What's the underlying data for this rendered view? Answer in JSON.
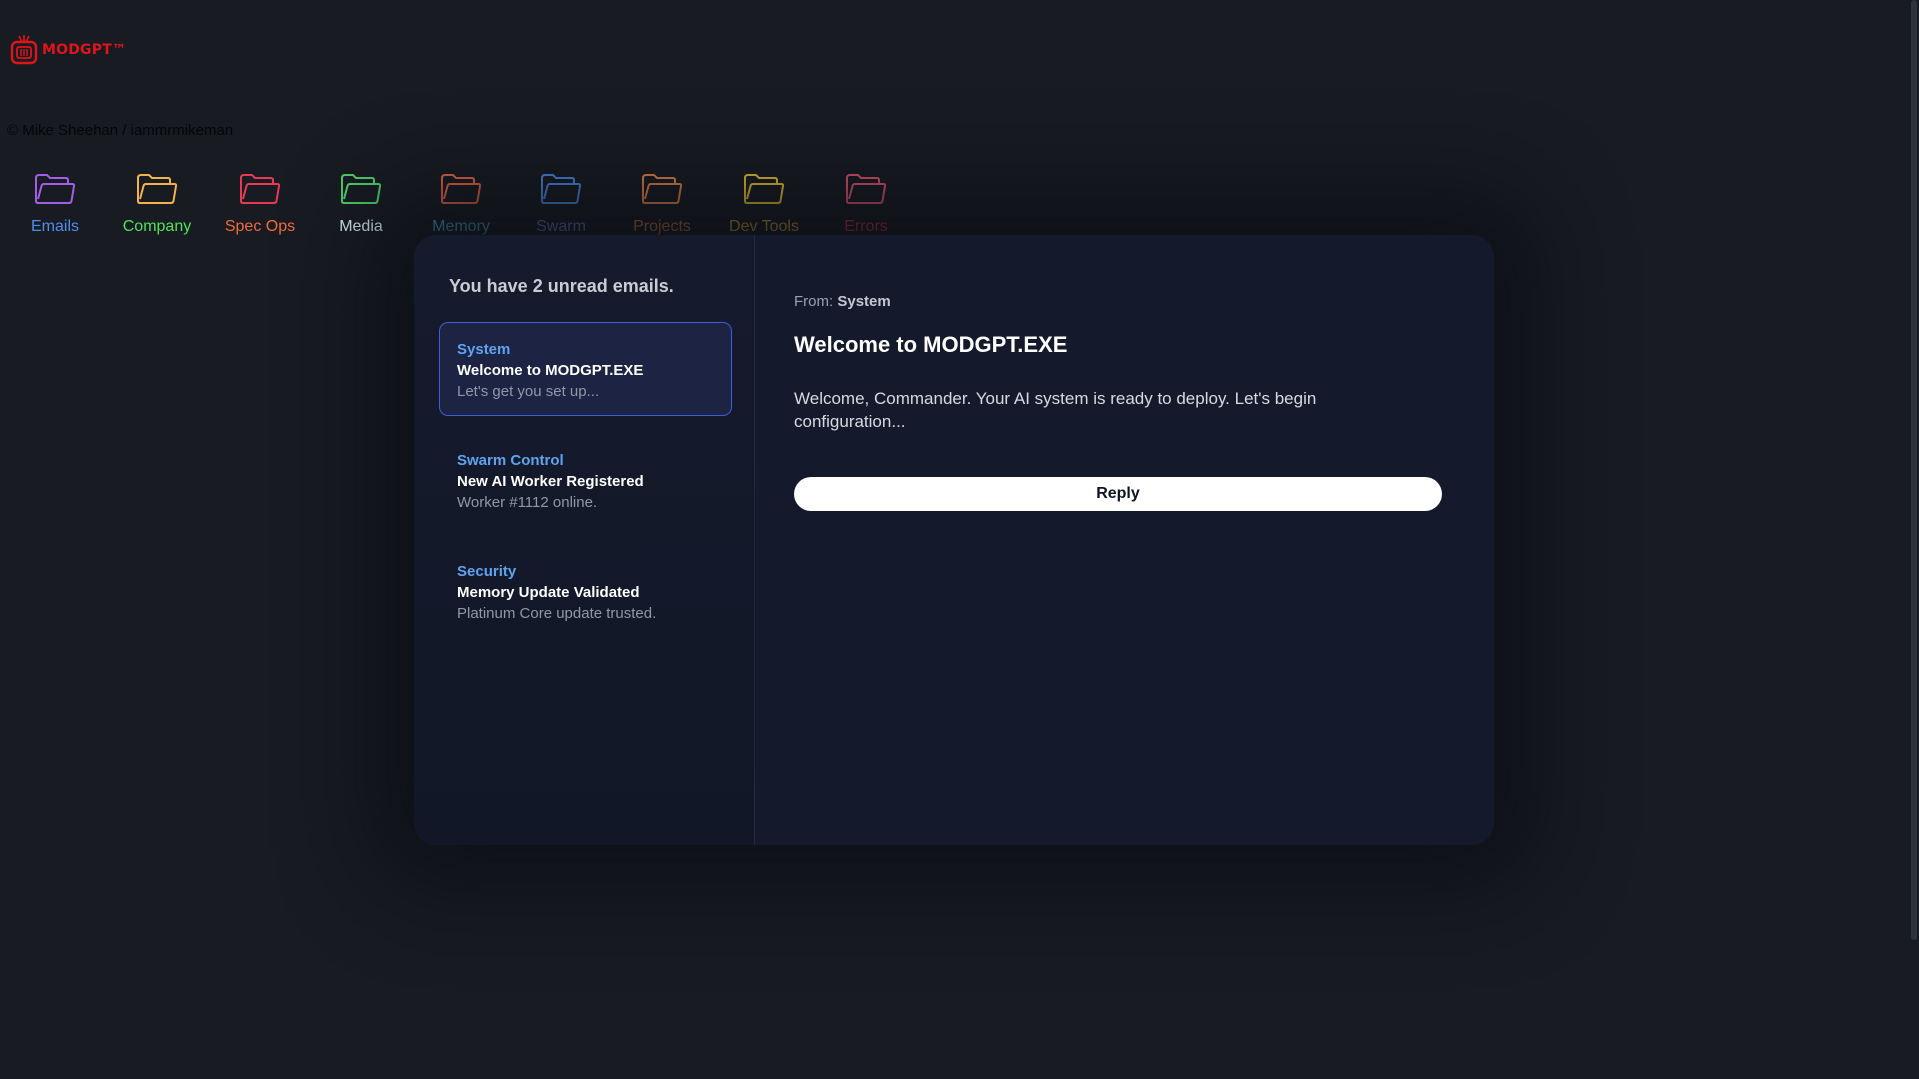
{
  "brand": {
    "logo_text": "MODGPT™",
    "accent": "#e0141b"
  },
  "copyright": "© Mike Sheehan / iammrmikeman",
  "folders": [
    {
      "label": "Emails",
      "icon": "folder-icon",
      "color": "#a05fe6",
      "label_color": "#4f8cf0"
    },
    {
      "label": "Company",
      "icon": "folder-icon",
      "color": "#f2b34a",
      "label_color": "#4ee35c"
    },
    {
      "label": "Spec Ops",
      "icon": "folder-icon",
      "color": "#e83a55",
      "label_color": "#f36a3c"
    },
    {
      "label": "Media",
      "icon": "folder-icon",
      "color": "#4fd06b",
      "label_color": "#d6f5f7"
    },
    {
      "label": "Memory",
      "icon": "folder-icon",
      "color": "#ef6a4c",
      "label_color": "#4fb4d6"
    },
    {
      "label": "Swarm",
      "icon": "folder-icon",
      "color": "#4f8ff0",
      "label_color": "#7a7fe0"
    },
    {
      "label": "Projects",
      "icon": "folder-icon",
      "color": "#f08a4c",
      "label_color": "#e28044"
    },
    {
      "label": "Dev Tools",
      "icon": "folder-icon",
      "color": "#f5d12e",
      "label_color": "#e6b33a"
    },
    {
      "label": "Errors",
      "icon": "folder-icon",
      "color": "#e85a6e",
      "label_color": "#e8343e"
    }
  ],
  "inbox": {
    "title": "You have 2 unread emails.",
    "emails": [
      {
        "sender": "System",
        "subject": "Welcome to MODGPT.EXE",
        "preview": "Let's get you set up...",
        "selected": true
      },
      {
        "sender": "Swarm Control",
        "subject": "New AI Worker Registered",
        "preview": "Worker #1112 online.",
        "selected": false
      },
      {
        "sender": "Security",
        "subject": "Memory Update Validated",
        "preview": "Platinum Core update trusted.",
        "selected": false
      }
    ]
  },
  "reader": {
    "from_label": "From:",
    "from_value": "System",
    "subject": "Welcome to MODGPT.EXE",
    "body": "Welcome, Commander. Your AI system is ready to deploy. Let's begin configuration...",
    "reply_label": "Reply"
  }
}
